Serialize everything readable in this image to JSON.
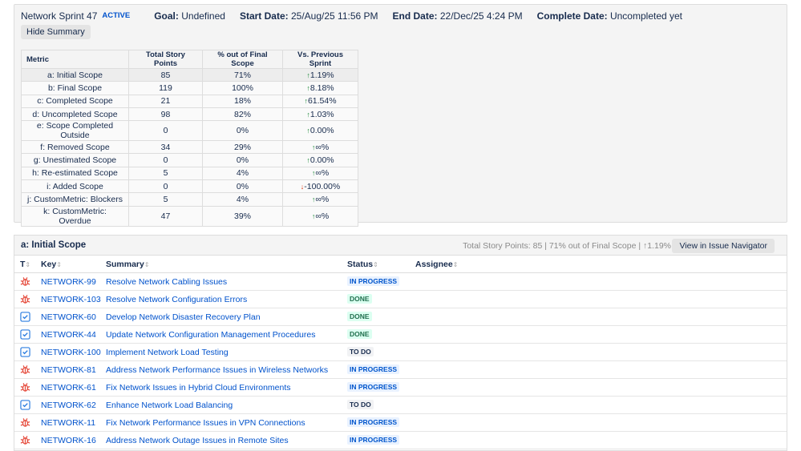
{
  "sprint": {
    "name": "Network Sprint 47",
    "state": "ACTIVE",
    "goal_label": "Goal:",
    "goal": "Undefined",
    "start_label": "Start Date:",
    "start": "25/Aug/25 11:56 PM",
    "end_label": "End Date:",
    "end": "22/Dec/25 4:24 PM",
    "complete_label": "Complete Date:",
    "complete": "Uncompleted yet",
    "hide_summary": "Hide Summary"
  },
  "summary_table": {
    "headers": [
      "Metric",
      "Total Story Points",
      "% out of Final Scope",
      "Vs. Previous Sprint"
    ],
    "rows": [
      {
        "metric": "a: Initial Scope",
        "points": "85",
        "pct": "71%",
        "dir": "up",
        "vs": "1.19%"
      },
      {
        "metric": "b: Final Scope",
        "points": "119",
        "pct": "100%",
        "dir": "up",
        "vs": "8.18%"
      },
      {
        "metric": "c: Completed Scope",
        "points": "21",
        "pct": "18%",
        "dir": "up",
        "vs": "61.54%"
      },
      {
        "metric": "d: Uncompleted Scope",
        "points": "98",
        "pct": "82%",
        "dir": "up",
        "vs": "1.03%"
      },
      {
        "metric": "e: Scope Completed Outside",
        "points": "0",
        "pct": "0%",
        "dir": "up",
        "vs": "0.00%"
      },
      {
        "metric": "f: Removed Scope",
        "points": "34",
        "pct": "29%",
        "dir": "up",
        "vs": "∞%"
      },
      {
        "metric": "g: Unestimated Scope",
        "points": "0",
        "pct": "0%",
        "dir": "up",
        "vs": "0.00%"
      },
      {
        "metric": "h: Re-estimated Scope",
        "points": "5",
        "pct": "4%",
        "dir": "up",
        "vs": "∞%"
      },
      {
        "metric": "i: Added Scope",
        "points": "0",
        "pct": "0%",
        "dir": "down",
        "vs": "-100.00%"
      },
      {
        "metric": "j: CustomMetric: Blockers",
        "points": "5",
        "pct": "4%",
        "dir": "up",
        "vs": "∞%"
      },
      {
        "metric": "k: CustomMetric: Overdue",
        "points": "47",
        "pct": "39%",
        "dir": "up",
        "vs": "∞%"
      }
    ]
  },
  "scope_section": {
    "title": "a: Initial Scope",
    "stats": "Total Story Points: 85 | 71% out of Final Scope | ↑1.19%",
    "nav_button": "View in Issue Navigator",
    "columns": [
      "T",
      "Key",
      "Summary",
      "Status",
      "Assignee"
    ],
    "issues": [
      {
        "type": "bug",
        "key": "NETWORK-99",
        "summary": "Resolve Network Cabling Issues",
        "status": "IN PROGRESS"
      },
      {
        "type": "bug",
        "key": "NETWORK-103",
        "summary": "Resolve Network Configuration Errors",
        "status": "DONE"
      },
      {
        "type": "task",
        "key": "NETWORK-60",
        "summary": "Develop Network Disaster Recovery Plan",
        "status": "DONE"
      },
      {
        "type": "task",
        "key": "NETWORK-44",
        "summary": "Update Network Configuration Management Procedures",
        "status": "DONE"
      },
      {
        "type": "task",
        "key": "NETWORK-100",
        "summary": "Implement Network Load Testing",
        "status": "TO DO"
      },
      {
        "type": "bug",
        "key": "NETWORK-81",
        "summary": "Address Network Performance Issues in Wireless Networks",
        "status": "IN PROGRESS"
      },
      {
        "type": "bug",
        "key": "NETWORK-61",
        "summary": "Fix Network Issues in Hybrid Cloud Environments",
        "status": "IN PROGRESS"
      },
      {
        "type": "task",
        "key": "NETWORK-62",
        "summary": "Enhance Network Load Balancing",
        "status": "TO DO"
      },
      {
        "type": "bug",
        "key": "NETWORK-11",
        "summary": "Fix Network Performance Issues in VPN Connections",
        "status": "IN PROGRESS"
      },
      {
        "type": "bug",
        "key": "NETWORK-16",
        "summary": "Address Network Outage Issues in Remote Sites",
        "status": "IN PROGRESS"
      }
    ]
  }
}
